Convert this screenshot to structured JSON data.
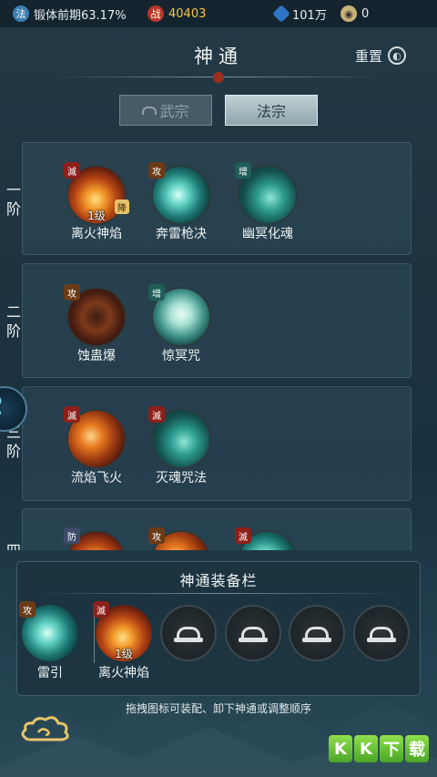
{
  "status_bar": {
    "realm_icon": "法",
    "realm_text": "锻体前期63.17%",
    "power_icon": "战",
    "power_value": "40403",
    "jade_value": "101万",
    "coin_value": "0"
  },
  "header": {
    "title": "神通",
    "reset_label": "重置"
  },
  "tabs": [
    {
      "label": "武宗",
      "active": false,
      "locked": true
    },
    {
      "label": "法宗",
      "active": true,
      "locked": false
    }
  ],
  "tiers": [
    {
      "label": "一阶",
      "skills": [
        {
          "name": "离火神焰",
          "badge": "滅",
          "level": "1级",
          "tag": "降"
        },
        {
          "name": "奔雷枪决",
          "badge": "攻"
        },
        {
          "name": "幽冥化魂",
          "badge": "增"
        }
      ]
    },
    {
      "label": "二阶",
      "skills": [
        {
          "name": "蚀蛊爆",
          "badge": "攻"
        },
        {
          "name": "惊冥咒",
          "badge": "增"
        }
      ]
    },
    {
      "label": "三阶",
      "skills": [
        {
          "name": "流焰飞火",
          "badge": "滅"
        },
        {
          "name": "灭魂咒法",
          "badge": "滅"
        }
      ]
    },
    {
      "label": "四",
      "skills": [
        {
          "badge": "防"
        },
        {
          "badge": "攻"
        },
        {
          "badge": "滅"
        }
      ]
    }
  ],
  "side_button": "YO AP",
  "equip": {
    "title": "神通装备栏",
    "main_skill": {
      "name": "雷引",
      "badge": "攻"
    },
    "slots": [
      {
        "name": "离火神焰",
        "badge": "滅",
        "level": "1级"
      }
    ],
    "empty_slots": 5,
    "hint": "拖拽图标可装配、卸下神通或调整顺序"
  },
  "watermark": [
    "K",
    "K",
    "下",
    "载"
  ],
  "colors": {
    "accent_gold": "#f3c54a",
    "badge_red": "#8e1f1a",
    "tab_active": "#bfd0d4"
  }
}
